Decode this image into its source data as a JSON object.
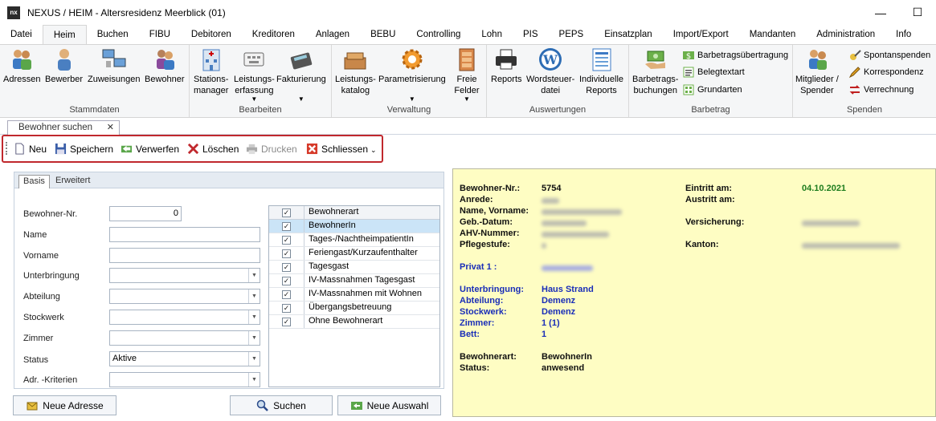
{
  "window": {
    "title": "NEXUS / HEIM - Altersresidenz Meerblick (01)",
    "logo": "nx",
    "minimize": "—",
    "maximize": "☐"
  },
  "menu": [
    "Datei",
    "Heim",
    "Buchen",
    "FIBU",
    "Debitoren",
    "Kreditoren",
    "Anlagen",
    "BEBU",
    "Controlling",
    "Lohn",
    "PIS",
    "PEPS",
    "Einsatzplan",
    "Import/Export",
    "Mandanten",
    "Administration",
    "Info"
  ],
  "ribbon": {
    "stammdaten": {
      "label": "Stammdaten",
      "buttons": [
        "Adressen",
        "Bewerber",
        "Zuweisungen",
        "Bewohner"
      ]
    },
    "bearbeiten": {
      "label": "Bearbeiten",
      "stations": [
        "Stations-",
        "manager"
      ],
      "leistungs": [
        "Leistungs-",
        "erfassung"
      ],
      "fakturierung": "Fakturierung"
    },
    "verwaltung": {
      "label": "Verwaltung",
      "katalog": [
        "Leistungs-",
        "katalog"
      ],
      "parametrisierung": "Parametrisierung",
      "felder": [
        "Freie",
        "Felder"
      ]
    },
    "auswertungen": {
      "label": "Auswertungen",
      "reports": "Reports",
      "wordsteuer": [
        "Wordsteuer-",
        "datei"
      ],
      "individuelle": [
        "Individuelle",
        "Reports"
      ]
    },
    "barbetrag": {
      "label": "Barbetrag",
      "buchungen": [
        "Barbetrags-",
        "buchungen"
      ],
      "uebertragung": "Barbetragsübertragung",
      "belegtextart": "Belegtextart",
      "grundarten": "Grundarten"
    },
    "spenden": {
      "label": "Spenden",
      "mitglieder": [
        "Mitglieder /",
        "Spender"
      ],
      "spontan": "Spontanspenden",
      "korrespondenz": "Korrespondenz",
      "verrechnung": "Verrechnung"
    }
  },
  "doctab": {
    "label": "Bewohner suchen",
    "close": "✕"
  },
  "toolbar": {
    "neu": "Neu",
    "speichern": "Speichern",
    "verwerfen": "Verwerfen",
    "loeschen": "Löschen",
    "drucken": "Drucken",
    "schliessen": "Schliessen"
  },
  "form": {
    "tabs": [
      "Basis",
      "Erweitert"
    ],
    "fields": {
      "bewohner_nr": {
        "label": "Bewohner-Nr.",
        "value": "0"
      },
      "name": {
        "label": "Name",
        "value": ""
      },
      "vorname": {
        "label": "Vorname",
        "value": ""
      },
      "unterbringung": {
        "label": "Unterbringung",
        "value": ""
      },
      "abteilung": {
        "label": "Abteilung",
        "value": ""
      },
      "stockwerk": {
        "label": "Stockwerk",
        "value": ""
      },
      "zimmer": {
        "label": "Zimmer",
        "value": ""
      },
      "status": {
        "label": "Status",
        "value": "Aktive"
      },
      "kriterien": {
        "label": "Adr. -Kriterien",
        "value": ""
      }
    },
    "bewohnerart": {
      "header": "Bewohnerart",
      "items": [
        "BewohnerIn",
        "Tages-/NachtheimpatientIn",
        "Feriengast/Kurzaufenthalter",
        "Tagesgast",
        "IV-Massnahmen Tagesgast",
        "IV-Massnahmen mit Wohnen",
        "Übergangsbetreuung",
        "Ohne Bewohnerart"
      ]
    }
  },
  "buttons": {
    "neue_adresse": "Neue Adresse",
    "suchen": "Suchen",
    "neue_auswahl": "Neue Auswahl"
  },
  "details": {
    "bewohner_nr": {
      "label": "Bewohner-Nr.:",
      "value": "5754"
    },
    "anrede": {
      "label": "Anrede:"
    },
    "name": {
      "label": "Name, Vorname:"
    },
    "geb": {
      "label": "Geb.-Datum:"
    },
    "ahv": {
      "label": "AHV-Nummer:"
    },
    "pflege": {
      "label": "Pflegestufe:"
    },
    "privat": {
      "label": "Privat 1 :"
    },
    "unterbringung": {
      "label": "Unterbringung:",
      "value": "Haus Strand"
    },
    "abteilung": {
      "label": "Abteilung:",
      "value": "Demenz"
    },
    "stockwerk": {
      "label": "Stockwerk:",
      "value": "Demenz"
    },
    "zimmer": {
      "label": "Zimmer:",
      "value": "1 (1)"
    },
    "bett": {
      "label": "Bett:",
      "value": "1"
    },
    "bewohnerart": {
      "label": "Bewohnerart:",
      "value": "BewohnerIn"
    },
    "status": {
      "label": "Status:",
      "value": "anwesend"
    },
    "eintritt": {
      "label": "Eintritt am:",
      "value": "04.10.2021"
    },
    "austritt": {
      "label": "Austritt am:"
    },
    "versicherung": {
      "label": "Versicherung:"
    },
    "kanton": {
      "label": "Kanton:"
    }
  }
}
